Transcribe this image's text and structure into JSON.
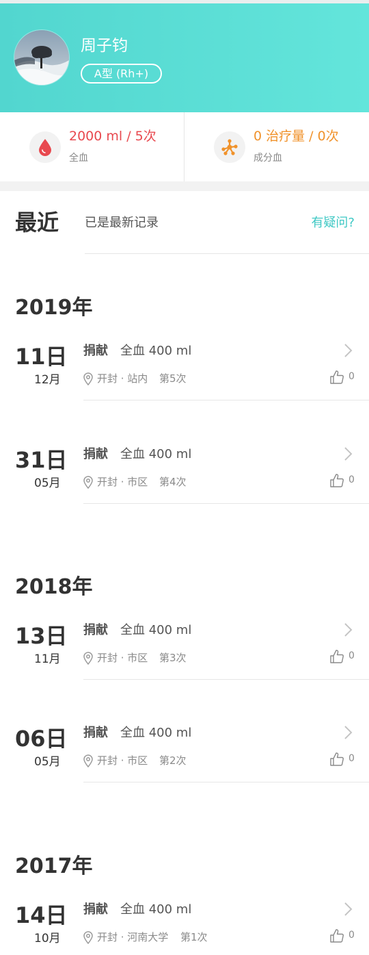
{
  "profile": {
    "name": "周子钧",
    "blood_type": "A型 (Rh+)"
  },
  "stats": {
    "whole_blood": {
      "value": "2000 ml / 5次",
      "label": "全血",
      "color": "#e8494f"
    },
    "component": {
      "value": "0 治疗量 / 0次",
      "label": "成分血",
      "color": "#f0922b"
    }
  },
  "recent": {
    "title": "最近",
    "status": "已是最新记录",
    "help": "有疑问?"
  },
  "years": [
    "2019年",
    "2018年",
    "2017年"
  ],
  "records": [
    {
      "day": "11日",
      "month": "12月",
      "type": "捐献",
      "amount": "全血 400 ml",
      "location": "开封 · 站内",
      "count": "第5次",
      "likes": "0"
    },
    {
      "day": "31日",
      "month": "05月",
      "type": "捐献",
      "amount": "全血 400 ml",
      "location": "开封 · 市区",
      "count": "第4次",
      "likes": "0"
    },
    {
      "day": "13日",
      "month": "11月",
      "type": "捐献",
      "amount": "全血 400 ml",
      "location": "开封 · 市区",
      "count": "第3次",
      "likes": "0"
    },
    {
      "day": "06日",
      "month": "05月",
      "type": "捐献",
      "amount": "全血 400 ml",
      "location": "开封 · 市区",
      "count": "第2次",
      "likes": "0"
    },
    {
      "day": "14日",
      "month": "10月",
      "type": "捐献",
      "amount": "全血 400 ml",
      "location": "开封 · 河南大学",
      "count": "第1次",
      "likes": "0"
    }
  ],
  "colors": {
    "accent": "#3ec8c4",
    "header_start": "#52d6cf",
    "header_end": "#63e5db"
  },
  "icons": {
    "whole_blood": "blood-drop-icon",
    "component": "molecule-icon",
    "location": "location-pin-icon",
    "like": "thumbs-up-icon",
    "chevron": "chevron-right-icon"
  }
}
